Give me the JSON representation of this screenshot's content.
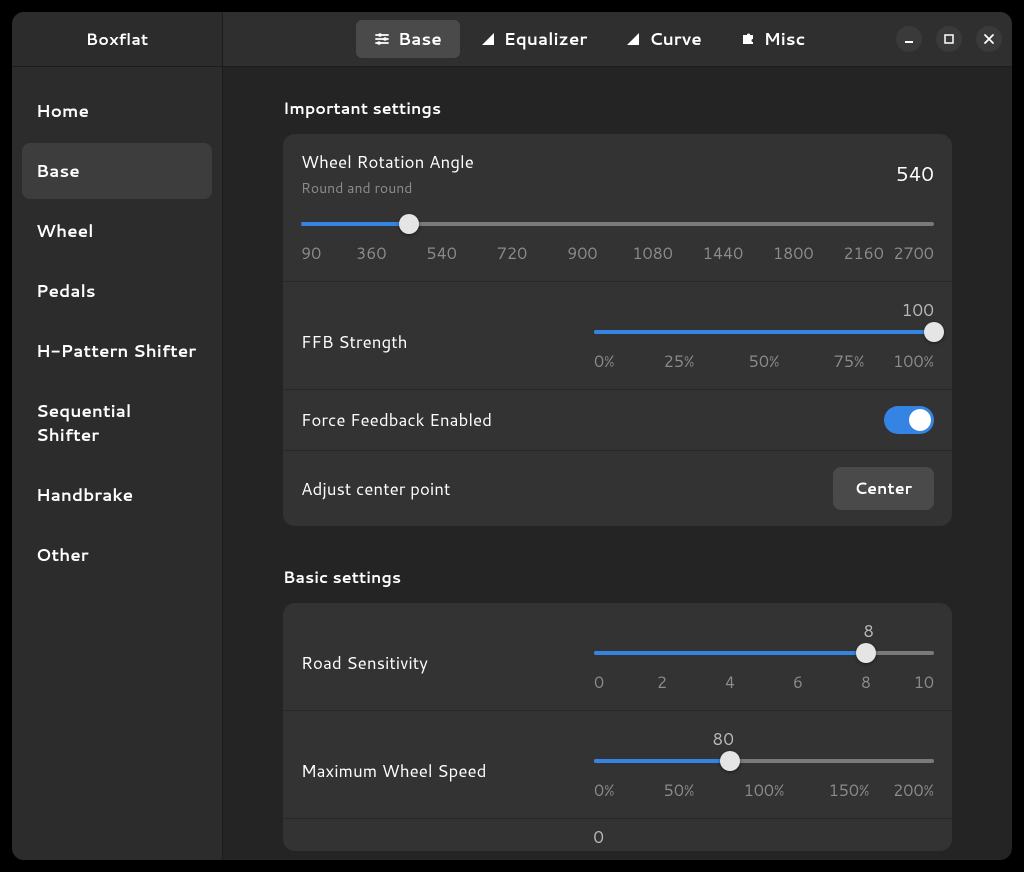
{
  "app_title": "Boxflat",
  "sidebar": {
    "items": [
      {
        "label": "Home"
      },
      {
        "label": "Base",
        "active": true
      },
      {
        "label": "Wheel"
      },
      {
        "label": "Pedals"
      },
      {
        "label": "H-Pattern Shifter"
      },
      {
        "label": "Sequential Shifter"
      },
      {
        "label": "Handbrake"
      },
      {
        "label": "Other"
      }
    ]
  },
  "header": {
    "tabs": [
      {
        "label": "Base",
        "icon": "sliders-icon",
        "active": true
      },
      {
        "label": "Equalizer",
        "icon": "signal-icon"
      },
      {
        "label": "Curve",
        "icon": "signal-icon"
      },
      {
        "label": "Misc",
        "icon": "puzzle-icon"
      }
    ]
  },
  "sections": {
    "important": {
      "title": "Important settings",
      "rotation": {
        "label": "Wheel Rotation Angle",
        "subtitle": "Round and round",
        "value": "540",
        "ticks": [
          "90",
          "360",
          "540",
          "720",
          "900",
          "1080",
          "1440",
          "1800",
          "2160",
          "2700"
        ],
        "fill_pct": 17
      },
      "ffb_strength": {
        "label": "FFB Strength",
        "value": "100",
        "ticks": [
          "0%",
          "25%",
          "50%",
          "75%",
          "100%"
        ],
        "fill_pct": 100
      },
      "ffb_enabled": {
        "label": "Force Feedback Enabled",
        "on": true
      },
      "center": {
        "label": "Adjust center point",
        "button": "Center"
      }
    },
    "basic": {
      "title": "Basic settings",
      "road_sens": {
        "label": "Road Sensitivity",
        "value": "8",
        "ticks": [
          "0",
          "2",
          "4",
          "6",
          "8",
          "10"
        ],
        "fill_pct": 80
      },
      "max_speed": {
        "label": "Maximum Wheel Speed",
        "value": "80",
        "ticks": [
          "0%",
          "50%",
          "100%",
          "150%",
          "200%"
        ],
        "fill_pct": 40
      },
      "next_value": "0"
    }
  },
  "colors": {
    "accent": "#3584e4"
  }
}
